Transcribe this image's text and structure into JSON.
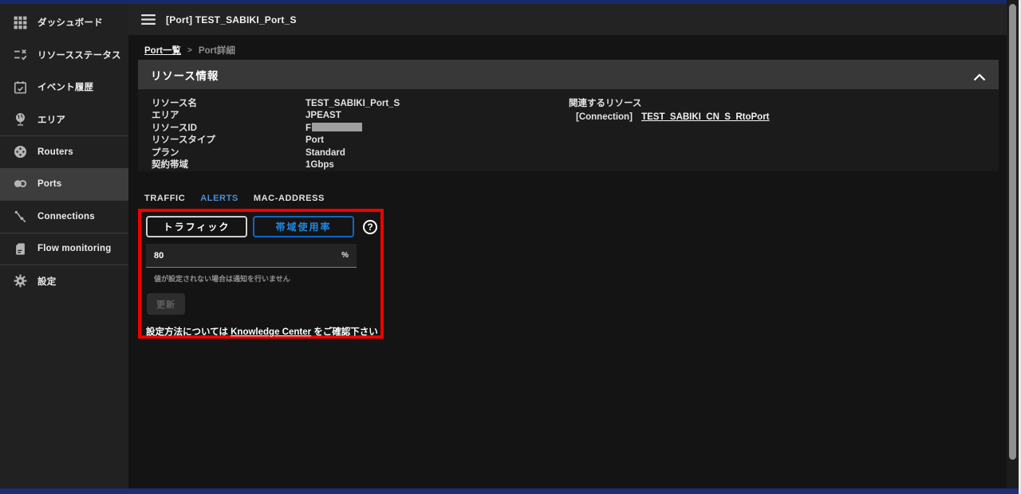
{
  "colors": {
    "accent_blue_tab": "#4d8ed3",
    "button_blue_border": "#1565c0",
    "button_blue_text": "#1e88e5",
    "annotation_red": "#ee0000",
    "top_strip_blue": "#18296b"
  },
  "sidebar": {
    "items": [
      {
        "label": "ダッシュボード",
        "icon": "dashboard-grid-icon",
        "active": false
      },
      {
        "label": "リソースステータス",
        "icon": "rule-checklist-icon",
        "active": false
      },
      {
        "label": "イベント履歴",
        "icon": "calendar-event-icon",
        "active": false
      },
      {
        "label": "エリア",
        "icon": "globe-stand-icon",
        "active": false
      },
      {
        "label": "Routers",
        "icon": "router-icon",
        "active": false
      },
      {
        "label": "Ports",
        "icon": "ports-icon",
        "active": true
      },
      {
        "label": "Connections",
        "icon": "connection-icon",
        "active": false
      },
      {
        "label": "Flow monitoring",
        "icon": "document-icon",
        "active": false
      },
      {
        "label": "設定",
        "icon": "gear-icon",
        "active": false
      }
    ]
  },
  "topbar": {
    "title": "[Port] TEST_SABIKI_Port_S"
  },
  "breadcrumb": {
    "link": "Port一覧",
    "separator": ">",
    "current": "Port詳細"
  },
  "resource_panel": {
    "title": "リソース情報",
    "fields": [
      {
        "label": "リソース名",
        "value": "TEST_SABIKI_Port_S"
      },
      {
        "label": "エリア",
        "value": "JPEAST"
      },
      {
        "label": "リソースID",
        "value": "F",
        "redacted": true
      },
      {
        "label": "リソースタイプ",
        "value": "Port"
      },
      {
        "label": "プラン",
        "value": "Standard"
      },
      {
        "label": "契約帯域",
        "value": "1Gbps"
      }
    ],
    "related": {
      "title": "関連するリソース",
      "type": "[Connection]",
      "link": "TEST_SABIKI_CN_S_RtoPort"
    }
  },
  "tabs": [
    {
      "label": "TRAFFIC",
      "active": false
    },
    {
      "label": "ALERTS",
      "active": true
    },
    {
      "label": "MAC-ADDRESS",
      "active": false
    }
  ],
  "alerts": {
    "traffic_button": "トラフィック",
    "bandwidth_button": "帯域使用率",
    "help_glyph": "?",
    "threshold_value": "80",
    "unit": "%",
    "helper_text": "値が設定されない場合は通知を行いません",
    "update_button": "更新",
    "footer": {
      "prefix": "設定方法については ",
      "link": "Knowledge Center",
      "suffix": " をご確認下さい"
    }
  }
}
